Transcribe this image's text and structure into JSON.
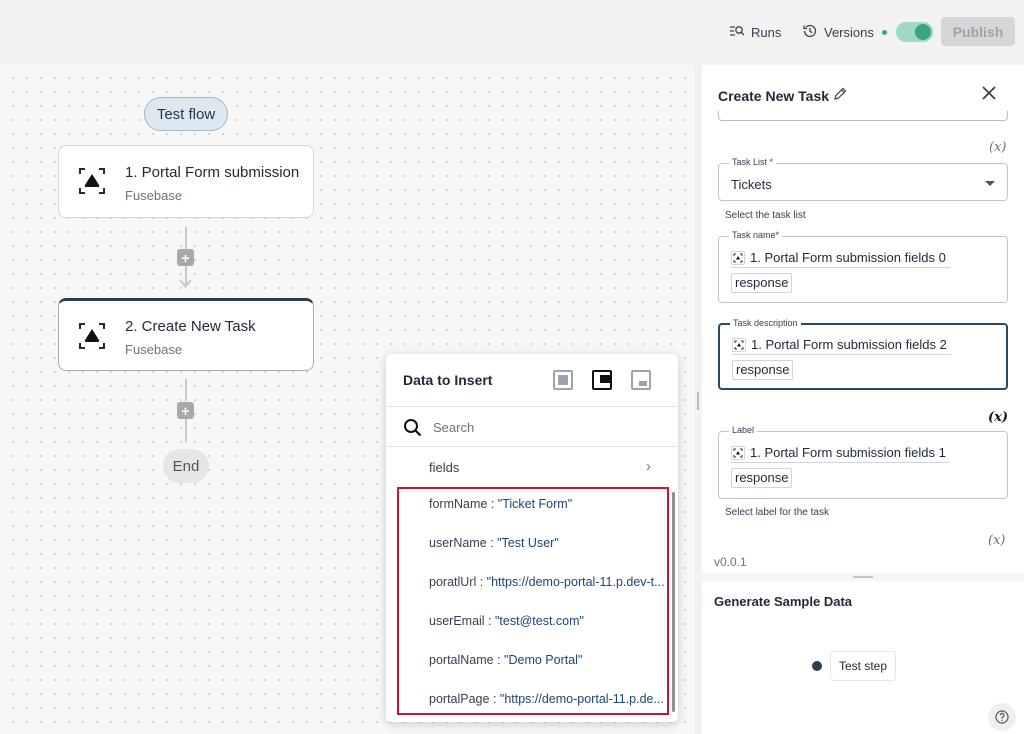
{
  "topbar": {
    "runs_label": "Runs",
    "versions_label": "Versions",
    "publish_label": "Publish"
  },
  "flow": {
    "test_flow_label": "Test flow",
    "steps": [
      {
        "title": "1. Portal Form submission",
        "subtitle": "Fusebase"
      },
      {
        "title": "2. Create New Task",
        "subtitle": "Fusebase"
      }
    ],
    "end_label": "End",
    "add_label": "+"
  },
  "data_popup": {
    "title": "Data to Insert",
    "search_placeholder": "Search",
    "fields_label": "fields",
    "items": [
      {
        "key": "formName",
        "value": "\"Ticket Form\""
      },
      {
        "key": "userName",
        "value": "\"Test User\""
      },
      {
        "key": "poratlUrl",
        "value": "\"https://demo-portal-11.p.dev-t..."
      },
      {
        "key": "userEmail",
        "value": "\"test@test.com\""
      },
      {
        "key": "portalName",
        "value": "\"Demo Portal\""
      },
      {
        "key": "portalPage",
        "value": "\"https://demo-portal-11.p.de..."
      }
    ],
    "separator": " : "
  },
  "panel": {
    "title": "Create New Task",
    "var_symbol": "(x)",
    "task_list": {
      "label": "Task List *",
      "value": "Tickets",
      "helper": "Select the task list"
    },
    "task_name": {
      "label": "Task name*",
      "chip": "1. Portal Form submission fields 0",
      "token": "response"
    },
    "task_description": {
      "label": "Task description",
      "chip": "1. Portal Form submission fields 2",
      "token": "response"
    },
    "label_field": {
      "label": "Label",
      "chip": "1. Portal Form submission fields 1",
      "token": "response",
      "helper": "Select label for the task"
    },
    "version": "v0.0.1",
    "generate_title": "Generate Sample Data",
    "test_step_label": "Test step"
  }
}
